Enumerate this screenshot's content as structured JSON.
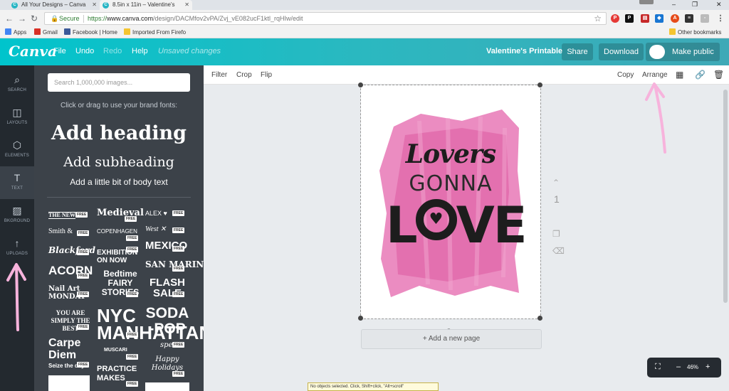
{
  "browser": {
    "tabs": [
      {
        "title": "All Your Designs – Canva",
        "active": false
      },
      {
        "title": "8.5in x 11in – Valentine's",
        "active": true
      }
    ],
    "url_secure_label": "Secure",
    "url_scheme": "https://",
    "url_host": "www.canva.com",
    "url_path": "/design/DACMfov2vPA/Zvj_vE082ucF1ktl_rqHIw/edit",
    "bookmarks": [
      "Apps",
      "Gmail",
      "Facebook | Home",
      "Imported From Firefo",
      "Other bookmarks"
    ],
    "window_controls": [
      "–",
      "❐",
      "✕"
    ]
  },
  "topbar": {
    "logo": "Canva",
    "menu": [
      "File",
      "Undo",
      "Redo",
      "Help"
    ],
    "unsaved": "Unsaved changes",
    "doc_title": "Valentine's Printable",
    "share": "Share",
    "download": "Download",
    "make_public": "Make public"
  },
  "rail": [
    {
      "label": "SEARCH",
      "icon": "search-icon",
      "glyph": "⌕"
    },
    {
      "label": "LAYOUTS",
      "icon": "layouts-icon",
      "glyph": "◫"
    },
    {
      "label": "ELEMENTS",
      "icon": "elements-icon",
      "glyph": "⬡"
    },
    {
      "label": "TEXT",
      "icon": "text-icon",
      "glyph": "T"
    },
    {
      "label": "BKGROUND",
      "icon": "background-icon",
      "glyph": "▨"
    },
    {
      "label": "UPLOADS",
      "icon": "upload-icon",
      "glyph": "↑"
    }
  ],
  "panel": {
    "search_placeholder": "Search 1,000,000 images...",
    "hint": "Click or drag to use your brand fonts:",
    "add_heading": "Add heading",
    "add_subheading": "Add subheading",
    "add_body": "Add a little bit of body text",
    "free_label": "FREE",
    "combos": [
      "THE NEW",
      "Medieval",
      "ALEX ♥",
      "Smith &",
      "COPENHAGEN",
      "West ✕",
      "Blackford",
      "EXHIBITION ON NOW",
      "MEXICO",
      "ACORN",
      "Bedtime FAIRY STORIES",
      "SAN MARINO",
      "Nail Art MONDAY",
      "FLASH SALE",
      "YOU ARE SIMPLY THE BEST",
      "NYC MANHATTAN",
      "SODA -POP",
      "Carpe Diem",
      "Seize the day",
      "MUSCARI",
      "spe",
      "PRACTICE MAKES",
      "Happy Holidays"
    ]
  },
  "toolbar": {
    "filter": "Filter",
    "crop": "Crop",
    "flip": "Flip",
    "copy": "Copy",
    "arrange": "Arrange"
  },
  "canvas": {
    "line1": "Lovers",
    "line2": "GONNA",
    "love_l": "L",
    "love_ve": "VE",
    "page_number": "1",
    "add_page": "+ Add a new page"
  },
  "zoom": {
    "minus": "–",
    "value": "46%",
    "plus": "+"
  },
  "status_tip": "No objects selected. Click, Shift+click, \"Alt+scroll\"",
  "colors": {
    "topbar_start": "#00c4cc",
    "topbar_end": "#3fa9b7",
    "rail_bg": "#23292f",
    "panel_bg": "#3c4249",
    "watercolor_pink": "#e25fa3",
    "annotation_arrow": "#f7b3dc"
  }
}
